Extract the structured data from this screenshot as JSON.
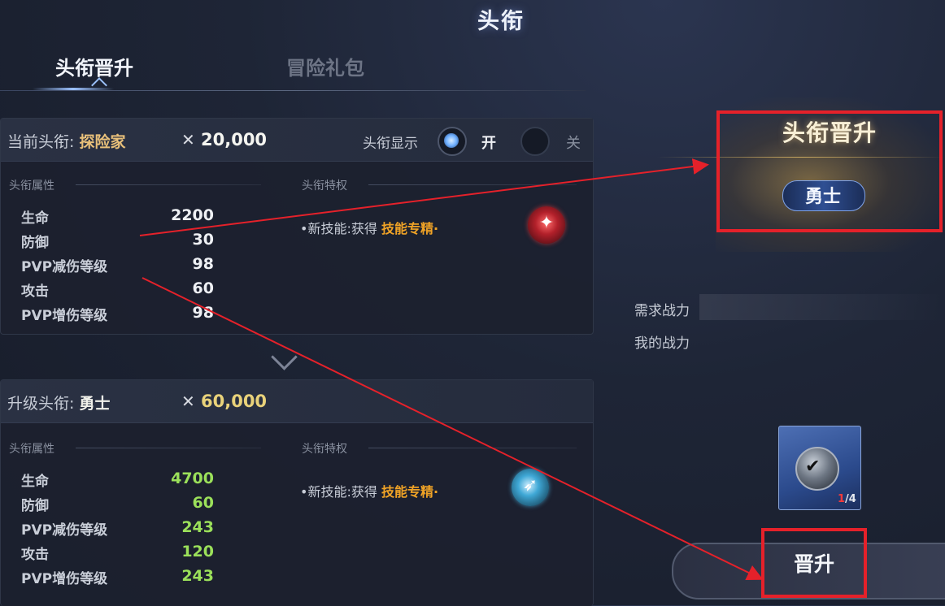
{
  "window": {
    "title": "头衔"
  },
  "tabs": [
    {
      "label": "头衔晋升",
      "active": true
    },
    {
      "label": "冒险礼包",
      "active": false
    }
  ],
  "current": {
    "label": "当前头衔:",
    "rank": "探险家",
    "power_icon": "crossed-swords-icon",
    "power": "20,000",
    "display_label": "头衔显示",
    "on_label": "开",
    "off_label": "关",
    "attr_label": "头衔属性",
    "perk_label": "头衔特权",
    "stats": [
      {
        "name": "生命",
        "value": "2200"
      },
      {
        "name": "防御",
        "value": "30"
      },
      {
        "name": "PVP减伤等级",
        "value": "98"
      },
      {
        "name": "攻击",
        "value": "60"
      },
      {
        "name": "PVP增伤等级",
        "value": "98"
      }
    ],
    "perk_prefix": "•新技能:获得",
    "perk_highlight": "技能专精·"
  },
  "upgrade": {
    "label": "升级头衔:",
    "rank": "勇士",
    "power": "60,000",
    "attr_label": "头衔属性",
    "perk_label": "头衔特权",
    "stats": [
      {
        "name": "生命",
        "value": "4700"
      },
      {
        "name": "防御",
        "value": "60"
      },
      {
        "name": "PVP减伤等级",
        "value": "243"
      },
      {
        "name": "攻击",
        "value": "120"
      },
      {
        "name": "PVP增伤等级",
        "value": "243"
      }
    ],
    "perk_prefix": "•新技能:获得",
    "perk_highlight": "技能专精·"
  },
  "promotion": {
    "title": "头衔晋升",
    "rank": "勇士",
    "required_power_label": "需求战力",
    "my_power_label": "我的战力",
    "item": {
      "count_have": "1",
      "count_need": "/4"
    },
    "button_label": "晋升"
  },
  "colors": {
    "highlight_orange": "#f0a326",
    "stat_green": "#9be05a",
    "annotation_red": "#e5212a",
    "rank_gold": "#e8c07a"
  }
}
